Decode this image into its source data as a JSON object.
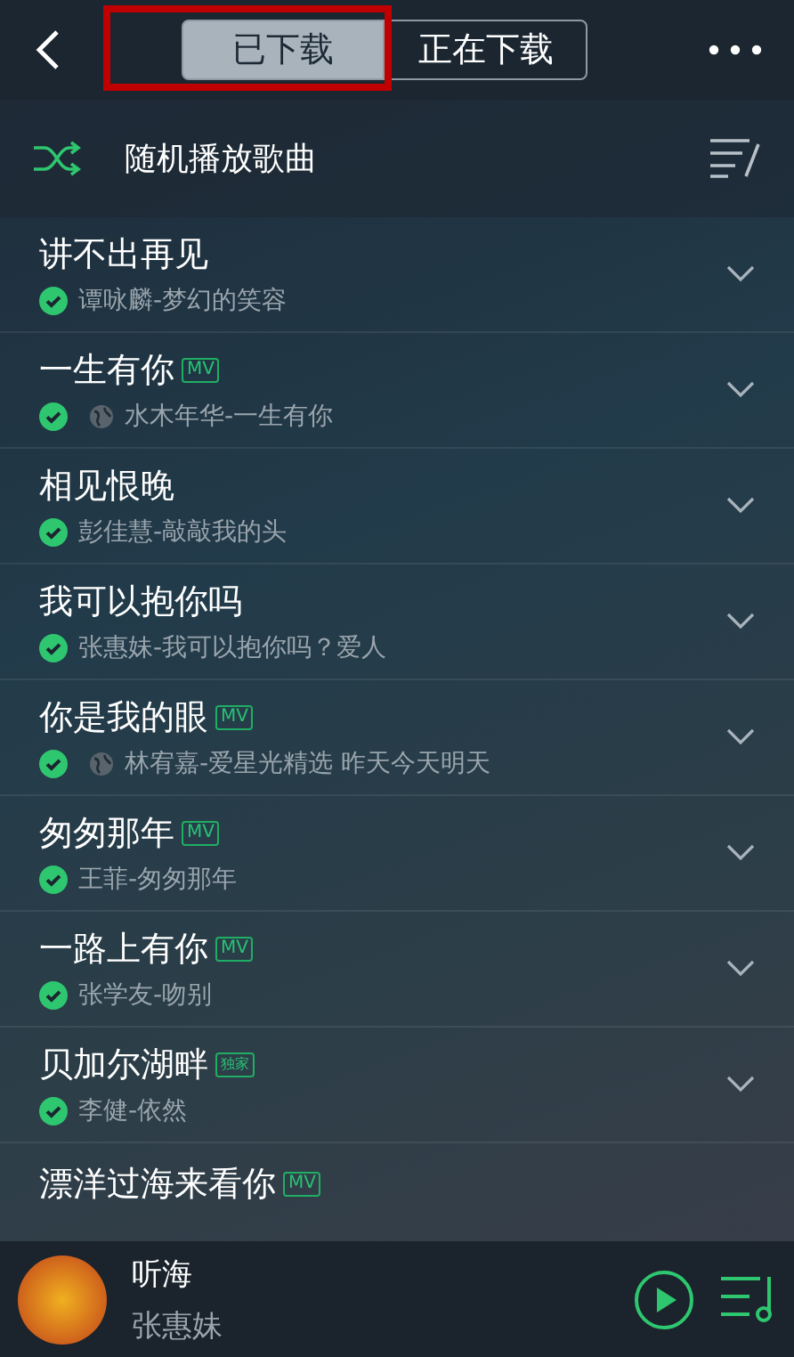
{
  "header": {
    "tabs": [
      {
        "label": "已下载",
        "selected": true,
        "annotated": true
      },
      {
        "label": "正在下载",
        "selected": false,
        "annotated": false
      }
    ]
  },
  "shuffle": {
    "label": "随机播放歌曲"
  },
  "songs": [
    {
      "title": "讲不出再见",
      "downloaded": true,
      "online": false,
      "subtitle": "谭咏麟-梦幻的笑容"
    },
    {
      "title": "一生有你",
      "badge": {
        "kind": "mv",
        "text": "MV"
      },
      "downloaded": true,
      "online": true,
      "subtitle": "水木年华-一生有你"
    },
    {
      "title": "相见恨晚",
      "downloaded": true,
      "online": false,
      "subtitle": "彭佳慧-敲敲我的头"
    },
    {
      "title": "我可以抱你吗",
      "downloaded": true,
      "online": false,
      "subtitle": "张惠妹-我可以抱你吗？爱人"
    },
    {
      "title": "你是我的眼",
      "badge": {
        "kind": "mv",
        "text": "MV"
      },
      "downloaded": true,
      "online": true,
      "subtitle": "林宥嘉-爱星光精选 昨天今天明天"
    },
    {
      "title": "匆匆那年",
      "badge": {
        "kind": "mv",
        "text": "MV"
      },
      "downloaded": true,
      "online": false,
      "subtitle": "王菲-匆匆那年"
    },
    {
      "title": "一路上有你",
      "badge": {
        "kind": "mv",
        "text": "MV"
      },
      "downloaded": true,
      "online": false,
      "subtitle": "张学友-吻别"
    },
    {
      "title": "贝加尔湖畔",
      "badge": {
        "kind": "exclusive",
        "text": "独家"
      },
      "downloaded": true,
      "online": false,
      "subtitle": "李健-依然"
    },
    {
      "title": "漂洋过海来看你",
      "badge": {
        "kind": "mv",
        "text": "MV"
      },
      "partial": true
    }
  ],
  "player": {
    "title": "听海",
    "artist": "张惠妹"
  }
}
